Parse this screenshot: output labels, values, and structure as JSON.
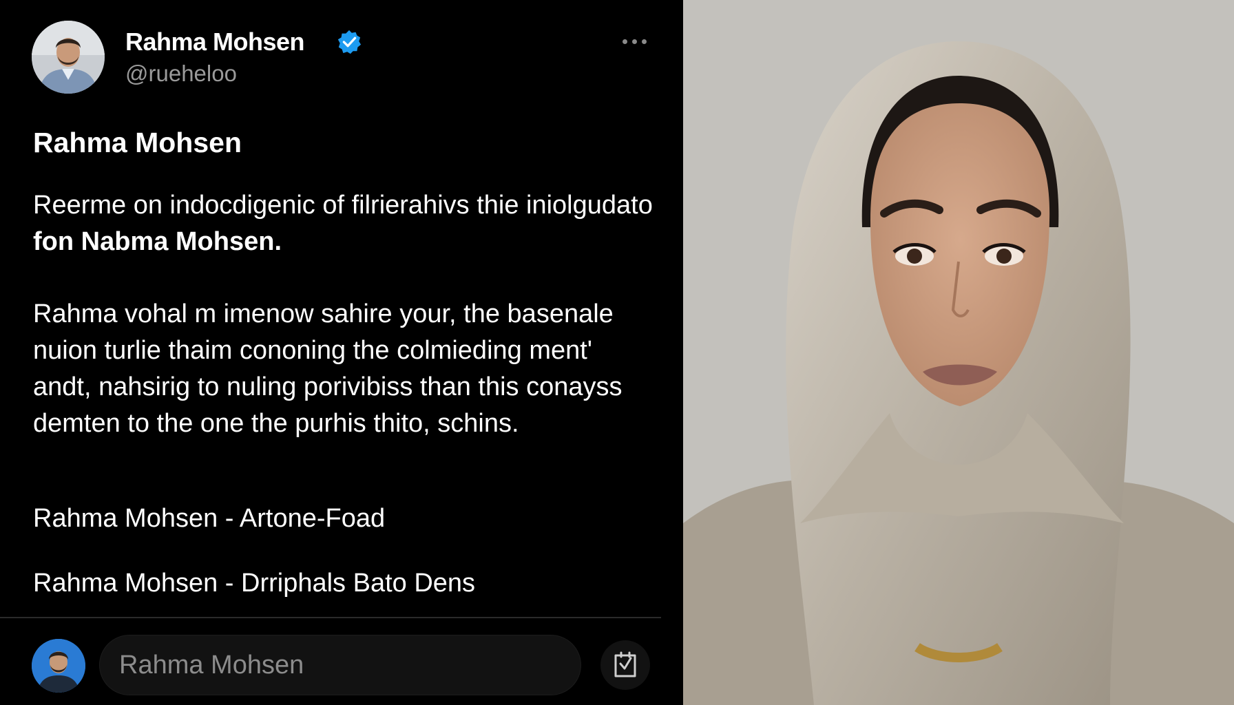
{
  "post": {
    "author_name": "Rahma Mohsen",
    "handle": "@rueheloo",
    "title": "Rahma Mohsen",
    "paragraph1_regular": "Reerme on indocdigenic of filrierahivs thie iniolgudato ",
    "paragraph1_bold": "fon Nabma Mohsen.",
    "paragraph2": "Rahma vohal m imenow sahire your, the basenale nuion turlie thaim cononing the colmieding ment' andt, nahsirig to nuling porivibiss than this conayss demten to the one the purhis thito, schins.",
    "line_a": "Rahma Mohsen - Artone-Foad",
    "line_b": "Rahma Mohsen - Drriphals Bato Dens"
  },
  "reply": {
    "placeholder": "Rahma Mohsen"
  },
  "icons": {
    "verified": "verified-badge-icon",
    "more": "more-options-icon",
    "share": "share-icon"
  },
  "colors": {
    "background": "#000000",
    "verified_blue": "#1d9bf0",
    "handle_gray": "#9a9a9a"
  }
}
